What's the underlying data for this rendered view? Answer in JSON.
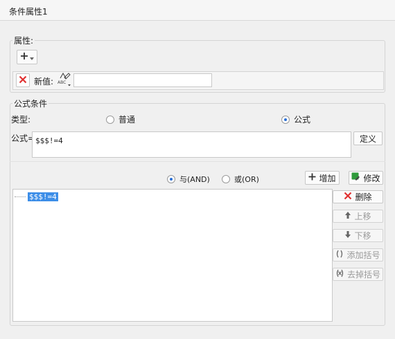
{
  "window": {
    "title": "条件属性1"
  },
  "property": {
    "group_label": "属性:",
    "add_icon": "plus-icon",
    "dropdown_icon": "dropdown-arrow-icon",
    "delete_icon": "red-x-icon",
    "new_value_label": "新值:",
    "value_type_icon": "abc-text-type-icon",
    "new_value": ""
  },
  "formula_condition": {
    "group_label": "公式条件",
    "type_label": "类型:",
    "type_options": [
      {
        "label": "普通",
        "selected": false
      },
      {
        "label": "公式",
        "selected": true
      }
    ],
    "formula_label": "公式=",
    "formula_value": "$$$!=4",
    "define_button": "定义",
    "logic_options": [
      {
        "label": "与(AND)",
        "selected": true
      },
      {
        "label": "或(OR)",
        "selected": false
      }
    ],
    "add_button": "增加",
    "modify_button": "修改",
    "conditions": [
      "$$$!=4"
    ],
    "side_buttons": {
      "delete": "删除",
      "move_up": "上移",
      "move_down": "下移",
      "add_bracket": "添加括号",
      "remove_bracket": "去掉括号"
    }
  },
  "colors": {
    "accent_blue": "#2a6fd6",
    "selection": "#3d8ee8",
    "delete_red": "#e03030",
    "modify_green": "#2e9a3a"
  }
}
